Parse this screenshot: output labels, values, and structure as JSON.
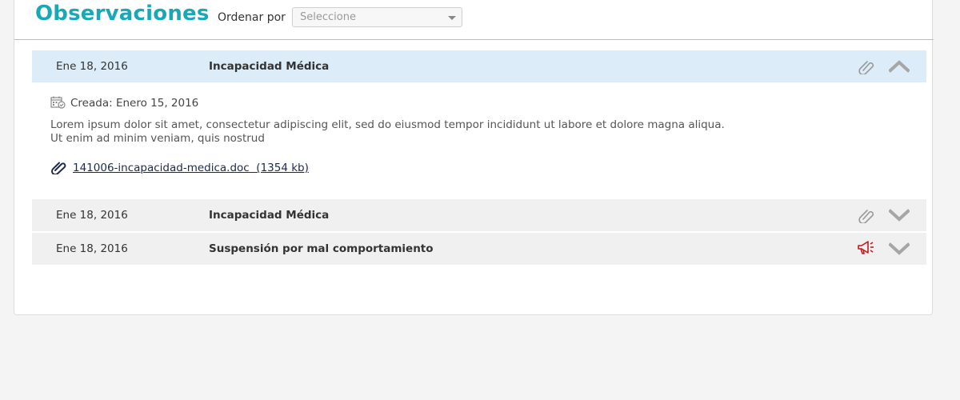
{
  "header": {
    "title": "Observaciones",
    "sort_label": "Ordenar por",
    "sort_select": {
      "value": "Seleccione"
    }
  },
  "observations": [
    {
      "date": "Ene 18, 2016",
      "title": "Incapacidad Médica",
      "expanded": true,
      "icon": "paperclip-icon",
      "toggle": "chevron-up-icon",
      "detail": {
        "created": "Creada: Enero 15, 2016",
        "body_line1": "Lorem ipsum dolor sit amet, consectetur adipiscing elit, sed do eiusmod tempor incididunt ut labore et dolore magna aliqua.",
        "body_line2": "Ut enim ad minim veniam, quis nostrud",
        "attachment": "141006-incapacidad-medica.doc  (1354 kb)"
      }
    },
    {
      "date": "Ene 18, 2016",
      "title": "Incapacidad Médica",
      "expanded": false,
      "icon": "paperclip-icon",
      "toggle": "chevron-down-icon"
    },
    {
      "date": "Ene 18, 2016",
      "title": "Suspensión por mal comportamiento",
      "expanded": false,
      "icon": "megaphone-icon",
      "toggle": "chevron-down-icon"
    }
  ],
  "colors": {
    "title": "#1ba8b6",
    "expanded_row": "#dcedf9",
    "collapsed_row": "#f0f0f0",
    "alert": "#c8161d",
    "icon_gray": "#9a9a9a"
  }
}
